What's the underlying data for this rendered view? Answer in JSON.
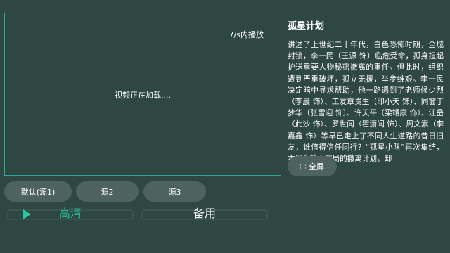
{
  "player": {
    "rate_text": "7/s内播放",
    "loading_text": "视频正在加载...."
  },
  "info": {
    "title": "孤星计划",
    "description": "讲述了上世纪二十年代，白色恐怖时期，全城封锁，李一民（王源 饰）临危受命，孤身担起护送重要人物秘密撤离的重任。但此时，组织遭到严重破坏，孤立无援，举步维艰。李一民决定暗中寻求帮助，他一路遇到了老师候少烈（李晨 饰）、工友章贵生（印小天 饰）、同窗丁梦华（张雪迎 饰）、许天平（梁靖康 饰）、江岳（此沙 饰）、罗世闻（翟潇闻 饰）、周文素（李嘉鑫 饰）等早已走上了不同人生道路的昔日旧友，谁值得信任同行？“孤星小队”再次集结，本以为精心布局的撤离计划，却"
  },
  "fullscreen_label": "全屏",
  "sources": [
    "默认(源1)",
    "源2",
    "源3"
  ],
  "quality": {
    "hd_label": "高清",
    "backup_label": "备用",
    "active": "高清",
    "active_color": "#27c7a3"
  },
  "icons": {
    "fullscreen": "fullscreen-icon",
    "play": "play-icon"
  }
}
